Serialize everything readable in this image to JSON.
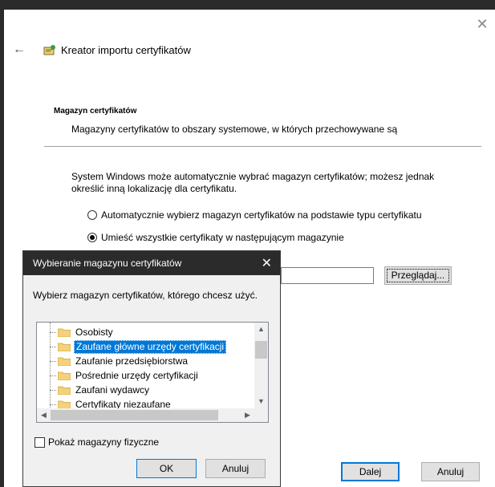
{
  "wizard": {
    "title": "Kreator importu certyfikatów",
    "section_heading": "Magazyn certyfikatów",
    "section_desc": "Magazyny certyfikatów to obszary systemowe, w których przechowywane są",
    "info_text": "System Windows może automatycznie wybrać magazyn certyfikatów; możesz jednak określić inną lokalizację dla certyfikatu.",
    "radio_auto": "Automatycznie wybierz magazyn certyfikatów na podstawie typu certyfikatu",
    "radio_manual": "Umieść wszystkie certyfikaty w następującym magazynie",
    "store_value": "",
    "browse_label": "Przeglądaj...",
    "next_label": "Dalej",
    "cancel_label": "Anuluj"
  },
  "dialog": {
    "title": "Wybieranie magazynu certyfikatów",
    "prompt": "Wybierz magazyn certyfikatów, którego chcesz użyć.",
    "items": [
      {
        "label": "Osobisty"
      },
      {
        "label": "Zaufane główne urzędy certyfikacji",
        "selected": true
      },
      {
        "label": "Zaufanie przedsiębiorstwa"
      },
      {
        "label": "Pośrednie urzędy certyfikacji"
      },
      {
        "label": "Zaufani wydawcy"
      },
      {
        "label": "Certyfikaty niezaufane"
      }
    ],
    "show_physical": "Pokaż magazyny fizyczne",
    "ok_label": "OK",
    "cancel_label": "Anuluj"
  },
  "colors": {
    "accent": "#0078d7",
    "titlebar": "#2b2b2b"
  },
  "icons": [
    "back-arrow-icon",
    "certificate-icon",
    "close-icon",
    "folder-icon"
  ]
}
